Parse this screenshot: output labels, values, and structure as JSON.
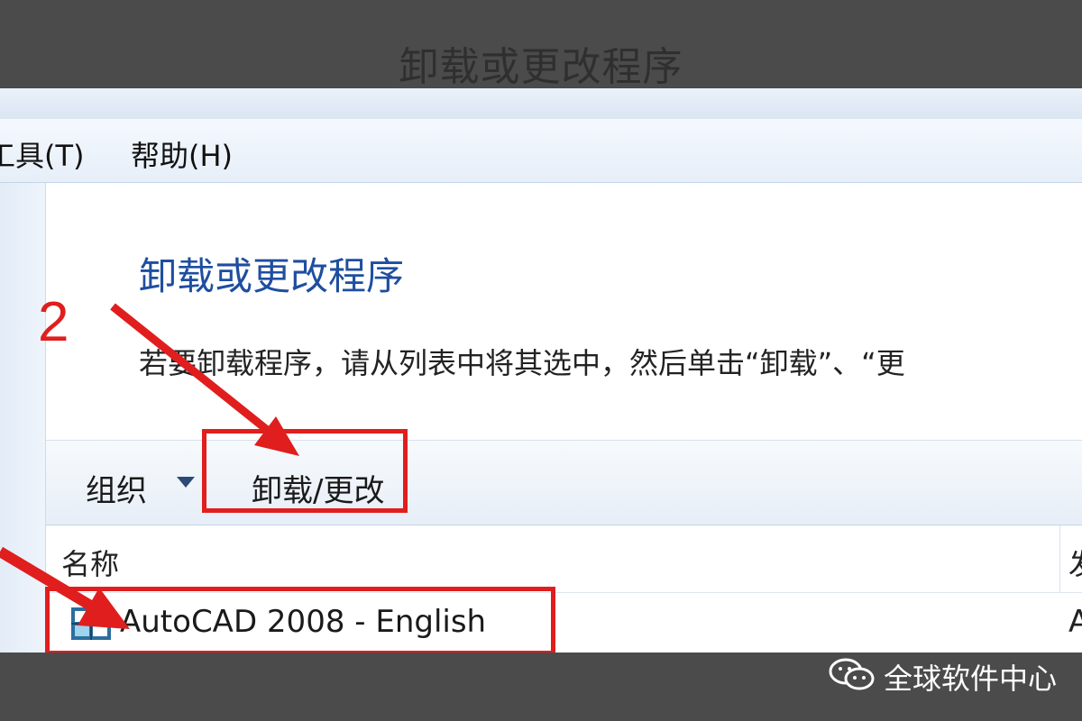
{
  "header_title": "卸载或更改程序",
  "menu": {
    "tools_label": "工具(T)",
    "help_label": "帮助(H)"
  },
  "content": {
    "title": "卸载或更改程序",
    "description": "若要卸载程序，请从列表中将其选中，然后单击“卸载”、“更"
  },
  "toolbar": {
    "organize_label": "组织",
    "uninstall_label": "卸载/更改"
  },
  "table": {
    "column_name": "名称",
    "column_next_partial": "发",
    "rows": [
      {
        "name": "AutoCAD 2008 - English",
        "next_partial": "A"
      }
    ]
  },
  "annotation": {
    "step_number": "2",
    "color": "#e01e1e"
  },
  "watermark": "全球软件中心",
  "icons": {
    "organize_dropdown": "caret-down-icon",
    "app": "autocad-icon",
    "watermark": "wechat-icon"
  }
}
